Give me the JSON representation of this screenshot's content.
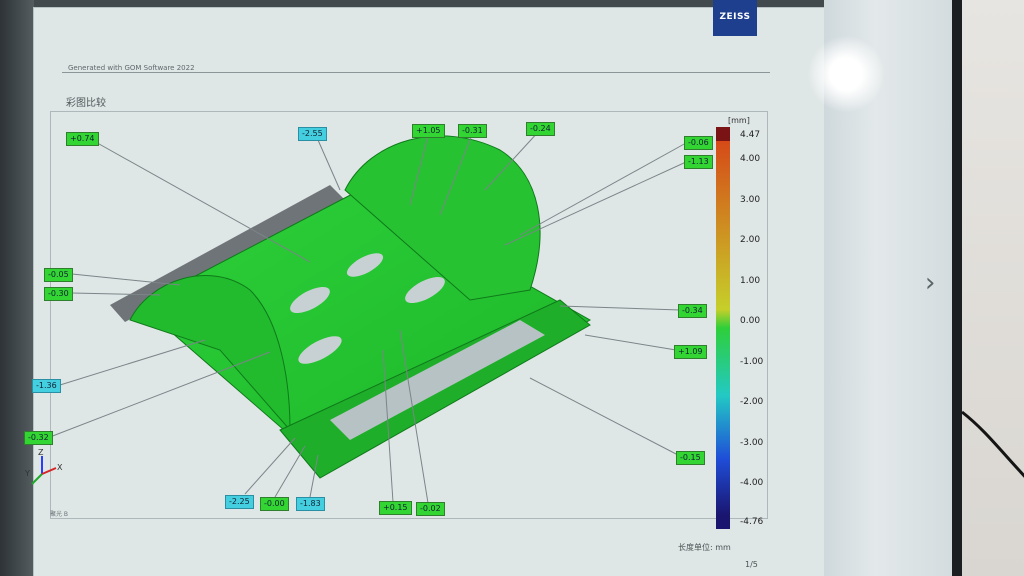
{
  "header": {
    "generated_with": "Generated with GOM Software 2022",
    "brand": "ZEISS"
  },
  "report": {
    "title": "彩图比较",
    "unit_header": "[mm]",
    "footer_units": "长度单位: mm",
    "page_number": "1/5",
    "bottom_left_note": "聚光 B"
  },
  "nav": {
    "next_icon": "chevron-right-icon",
    "next_glyph": "›"
  },
  "axes": {
    "x": "X",
    "y": "Y",
    "z": "Z"
  },
  "annotations": [
    {
      "id": "a1",
      "value": "+0.74",
      "style": "green"
    },
    {
      "id": "a2",
      "value": "-2.55",
      "style": "cyan"
    },
    {
      "id": "a3",
      "value": "+1.05",
      "style": "green"
    },
    {
      "id": "a4",
      "value": "-0.31",
      "style": "green"
    },
    {
      "id": "a5",
      "value": "-0.24",
      "style": "green"
    },
    {
      "id": "a6",
      "value": "-0.06",
      "style": "green"
    },
    {
      "id": "a7",
      "value": "-1.13",
      "style": "green"
    },
    {
      "id": "a8",
      "value": "-0.05",
      "style": "green"
    },
    {
      "id": "a9",
      "value": "-0.30",
      "style": "green"
    },
    {
      "id": "a10",
      "value": "-0.34",
      "style": "green"
    },
    {
      "id": "a11",
      "value": "+1.09",
      "style": "green"
    },
    {
      "id": "a12",
      "value": "-1.36",
      "style": "cyan"
    },
    {
      "id": "a13",
      "value": "-0.32",
      "style": "green"
    },
    {
      "id": "a14",
      "value": "-0.15",
      "style": "green"
    },
    {
      "id": "a15",
      "value": "-2.25",
      "style": "cyan"
    },
    {
      "id": "a16",
      "value": "-0.00",
      "style": "green"
    },
    {
      "id": "a17",
      "value": "-1.83",
      "style": "cyan"
    },
    {
      "id": "a18",
      "value": "+0.15",
      "style": "green"
    },
    {
      "id": "a19",
      "value": "-0.02",
      "style": "green"
    }
  ],
  "chart_data": {
    "type": "heatmap",
    "title": "",
    "colorbar": {
      "max": 4.47,
      "min": -4.76,
      "ticks": [
        "4.00",
        "3.00",
        "2.00",
        "1.00",
        "0.00",
        "-1.00",
        "-2.00",
        "-3.00",
        "-4.00"
      ],
      "tick_values": [
        4,
        3,
        2,
        1,
        0,
        -1,
        -2,
        -3,
        -4
      ],
      "colors": {
        "top": "#7a1313",
        "high": "#d64a18",
        "mid": "#2ecf3a",
        "low": "#1f4ed8",
        "bottom": "#1a1670"
      }
    }
  }
}
